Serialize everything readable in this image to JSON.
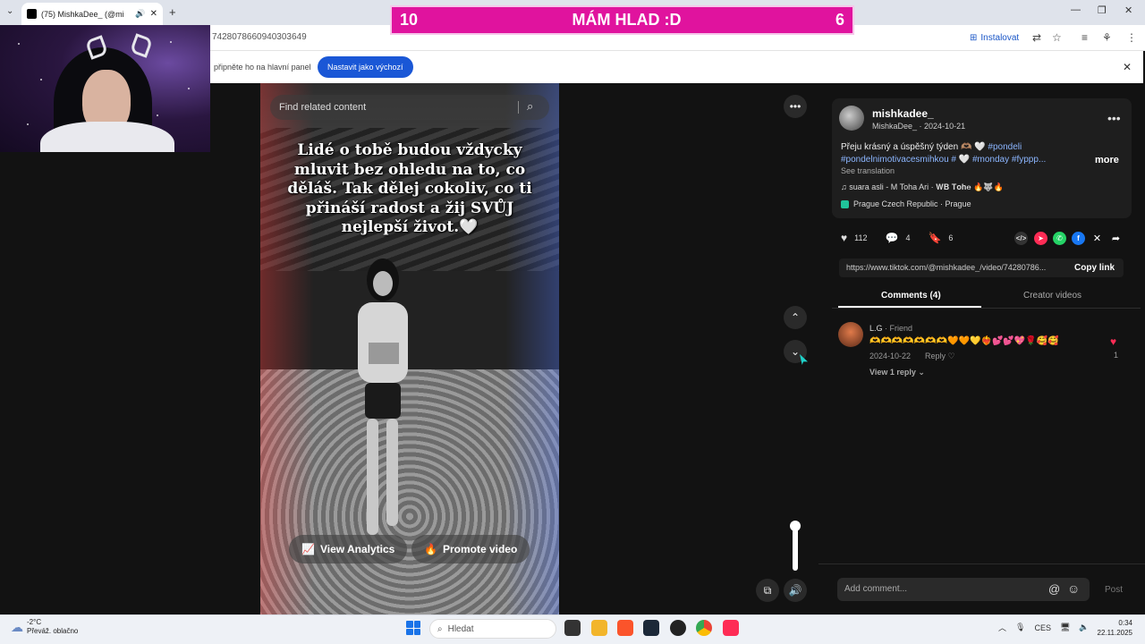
{
  "browser": {
    "tab_title": "(75) MishkaDee_ (@mi",
    "new_tab": "+",
    "url": "7428078660940303649",
    "install_label": "Instalovat",
    "infobar_text": "připněte ho na hlavní panel",
    "set_default_label": "Nastavit jako výchozí",
    "infobar_close": "✕"
  },
  "overlay": {
    "left_number": "10",
    "title": "MÁM HLAD :D",
    "right_number": "6"
  },
  "video": {
    "search_placeholder": "Find related content",
    "caption": "Lidé o tobě budou vždycky mluvit bez ohledu na to, co děláš. Tak dělej cokoliv, co ti přináší radost a žij SVŮJ nejlepší život.🤍",
    "view_analytics": "View Analytics",
    "promote_video": "Promote video",
    "volume_level": 1.0
  },
  "post": {
    "username": "mishkadee_",
    "nickname": "MishkaDee_",
    "date": "· 2024-10-21",
    "description_text": "Přeju krásný a úspěšný týden 🫶🏽 🤍 ",
    "tag1": "#pondeli",
    "tag2": "#pondelnimotivacesmihkou",
    "tag3": "# 🤍 #monday #fyppp...",
    "more": "more",
    "see_translation": "See translation",
    "music": "suara asli - M Toha Ari · 𝐖𝐁 𝐓𝐨𝐡𝐞 🔥🐺🔥",
    "location": "Prague Czech Republic · Prague",
    "likes": "112",
    "comments": "4",
    "saves": "6",
    "link": "https://www.tiktok.com/@mishkadee_/video/74280786...",
    "copy_link": "Copy link"
  },
  "tabs": {
    "comments": "Comments (4)",
    "creator_videos": "Creator videos"
  },
  "comment": {
    "author": "L.G",
    "tag": " · Friend",
    "text": "🫶🫶🫶🫶🫶🫶🫶🧡🧡💛❤️‍🔥💕💕💖🌹🥰🥰",
    "date": "2024-10-22",
    "reply": "Reply",
    "view_replies": "View 1 reply ⌄",
    "likes": "1"
  },
  "composer": {
    "placeholder": "Add comment...",
    "post": "Post"
  },
  "taskbar": {
    "temp": "-2°C",
    "weather": "Převáž. oblačno",
    "search": "Hledat",
    "lang": "CES",
    "time": "0:34",
    "date": "22.11.2025"
  },
  "colors": {
    "overlay_bg": "#e0139e",
    "accent_blue": "#1a57d6",
    "tiktok_red": "#fe2c55",
    "hashtag": "#8cb6ff"
  }
}
